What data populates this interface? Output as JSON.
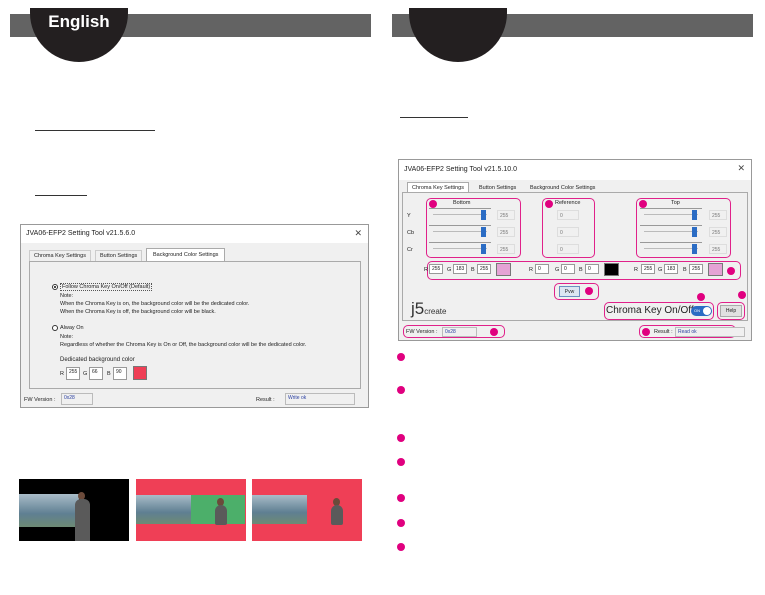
{
  "left_page": {
    "header": {
      "language": "English"
    },
    "window": {
      "title": "JVA06-EFP2 Setting Tool v21.5.6.0",
      "close": "✕",
      "tabs": [
        "Chroma Key Settings",
        "Button Settings",
        "Background Color Settings"
      ],
      "active_tab": "Background Color Settings",
      "option1": {
        "label": "Follow Chroma Key On/Off (Default)",
        "selected": true,
        "note_label": "Note:",
        "note_lines": [
          "When the Chroma Key is on, the background color will be the dedicated color.",
          "When the Chroma Key is off, the background color will be black."
        ]
      },
      "option2": {
        "label": "Alway On",
        "selected": false,
        "note_label": "Note:",
        "note_lines": [
          "Regardless of whether the Chroma Key is On or Off, the background color will be the dedicated color."
        ]
      },
      "dedicated_label": "Dedicated background color",
      "rgb": {
        "r_label": "R",
        "r": "255",
        "g_label": "G",
        "g": "66",
        "b_label": "B",
        "b": "90",
        "swatch": "#ef3f56"
      },
      "fw_label": "FW Version :",
      "fw_value": "0x28",
      "result_label": "Result :",
      "result_value": "Write ok"
    },
    "photos": {
      "bg_black": "#000000",
      "bg_red": "#ef3f56",
      "green": "#4caf6a"
    }
  },
  "right_page": {
    "window": {
      "title": "JVA06-EFP2 Setting Tool v21.5.10.0",
      "close": "✕",
      "tabs": [
        "Chroma Key Settings",
        "Button Settings",
        "Background Color Settings"
      ],
      "active_tab": "Chroma Key Settings",
      "bottom": {
        "title": "Bottom",
        "rows": [
          {
            "label": "Y",
            "value": "255"
          },
          {
            "label": "Cb",
            "value": "255"
          },
          {
            "label": "Cr",
            "value": "255"
          }
        ]
      },
      "reference": {
        "title": "Reference",
        "values": [
          "0",
          "0",
          "0"
        ]
      },
      "top": {
        "title": "Top",
        "values": [
          "255",
          "255",
          "255"
        ]
      },
      "rgb_bottom": {
        "r": "255",
        "g": "183",
        "b": "255",
        "swatch": "#e5a3d5"
      },
      "rgb_reference": {
        "r": "0",
        "g": "0",
        "b": "0",
        "swatch": "#000000"
      },
      "rgb_top": {
        "r": "255",
        "g": "183",
        "b": "255",
        "swatch": "#e5a3d5"
      },
      "labels": {
        "r": "R",
        "g": "G",
        "b": "B"
      },
      "pvw": "Pvw",
      "logo": "j5",
      "logo_suffix": "create",
      "chroma_toggle_label": "Chroma Key On/Off",
      "chroma_toggle_state": "ON",
      "help": "Help",
      "fw_label": "FW Version :",
      "fw_value": "0x28",
      "result_label": "Result :",
      "result_value": "Read ok"
    },
    "callout_color": "#e0007f"
  }
}
